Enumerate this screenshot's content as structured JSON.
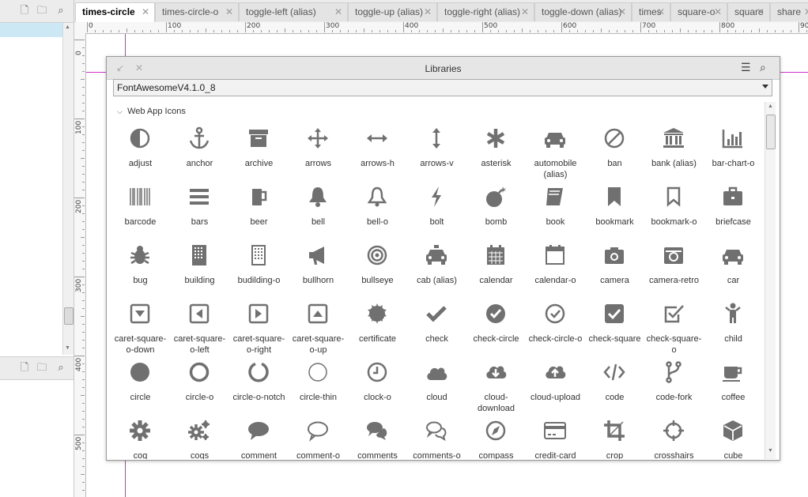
{
  "tabs": [
    {
      "label": "times-circle",
      "active": true
    },
    {
      "label": "times-circle-o",
      "active": false
    },
    {
      "label": "toggle-left (alias)",
      "active": false
    },
    {
      "label": "toggle-up (alias)",
      "active": false
    },
    {
      "label": "toggle-right (alias)",
      "active": false
    },
    {
      "label": "toggle-down (alias)",
      "active": false
    },
    {
      "label": "times",
      "active": false
    },
    {
      "label": "square-o",
      "active": false
    },
    {
      "label": "square",
      "active": false
    },
    {
      "label": "share",
      "active": false
    }
  ],
  "ruler": {
    "top_labels": [
      "0",
      "100",
      "200",
      "300",
      "400",
      "500",
      "600",
      "700",
      "800",
      "900"
    ],
    "left_labels": [
      "0",
      "100",
      "200",
      "300",
      "400",
      "500"
    ]
  },
  "dialog": {
    "title": "Libraries",
    "library_select": "FontAwesomeV4.1.0_8",
    "section": "Web App Icons",
    "colors": {
      "icon": "#707070",
      "accent": "#cc33cc",
      "selected": "#cce8f5"
    }
  },
  "icons": [
    {
      "label": "adjust",
      "icon": "adjust-icon"
    },
    {
      "label": "anchor",
      "icon": "anchor-icon"
    },
    {
      "label": "archive",
      "icon": "archive-icon"
    },
    {
      "label": "arrows",
      "icon": "arrows-icon"
    },
    {
      "label": "arrows-h",
      "icon": "arrows-h-icon"
    },
    {
      "label": "arrows-v",
      "icon": "arrows-v-icon"
    },
    {
      "label": "asterisk",
      "icon": "asterisk-icon"
    },
    {
      "label": "automobile (alias)",
      "icon": "automobile-icon"
    },
    {
      "label": "ban",
      "icon": "ban-icon"
    },
    {
      "label": "bank (alias)",
      "icon": "bank-icon"
    },
    {
      "label": "bar-chart-o",
      "icon": "bar-chart-icon"
    },
    {
      "label": "barcode",
      "icon": "barcode-icon"
    },
    {
      "label": "bars",
      "icon": "bars-icon"
    },
    {
      "label": "beer",
      "icon": "beer-icon"
    },
    {
      "label": "bell",
      "icon": "bell-icon"
    },
    {
      "label": "bell-o",
      "icon": "bell-o-icon"
    },
    {
      "label": "bolt",
      "icon": "bolt-icon"
    },
    {
      "label": "bomb",
      "icon": "bomb-icon"
    },
    {
      "label": "book",
      "icon": "book-icon"
    },
    {
      "label": "bookmark",
      "icon": "bookmark-icon"
    },
    {
      "label": "bookmark-o",
      "icon": "bookmark-o-icon"
    },
    {
      "label": "briefcase",
      "icon": "briefcase-icon"
    },
    {
      "label": "bug",
      "icon": "bug-icon"
    },
    {
      "label": "building",
      "icon": "building-icon"
    },
    {
      "label": "budilding-o",
      "icon": "building-o-icon"
    },
    {
      "label": "bullhorn",
      "icon": "bullhorn-icon"
    },
    {
      "label": "bullseye",
      "icon": "bullseye-icon"
    },
    {
      "label": "cab (alias)",
      "icon": "cab-icon"
    },
    {
      "label": "calendar",
      "icon": "calendar-icon"
    },
    {
      "label": "calendar-o",
      "icon": "calendar-o-icon"
    },
    {
      "label": "camera",
      "icon": "camera-icon"
    },
    {
      "label": "camera-retro",
      "icon": "camera-retro-icon"
    },
    {
      "label": "car",
      "icon": "car-icon"
    },
    {
      "label": "caret-square-o-down",
      "icon": "caret-square-o-down-icon"
    },
    {
      "label": "caret-square-o-left",
      "icon": "caret-square-o-left-icon"
    },
    {
      "label": "caret-square-o-right",
      "icon": "caret-square-o-right-icon"
    },
    {
      "label": "caret-square-o-up",
      "icon": "caret-square-o-up-icon"
    },
    {
      "label": "certificate",
      "icon": "certificate-icon"
    },
    {
      "label": "check",
      "icon": "check-icon"
    },
    {
      "label": "check-circle",
      "icon": "check-circle-icon"
    },
    {
      "label": "check-circle-o",
      "icon": "check-circle-o-icon"
    },
    {
      "label": "check-square",
      "icon": "check-square-icon"
    },
    {
      "label": "check-square-o",
      "icon": "check-square-o-icon"
    },
    {
      "label": "child",
      "icon": "child-icon"
    },
    {
      "label": "circle",
      "icon": "circle-icon"
    },
    {
      "label": "circle-o",
      "icon": "circle-o-icon"
    },
    {
      "label": "circle-o-notch",
      "icon": "circle-o-notch-icon"
    },
    {
      "label": "circle-thin",
      "icon": "circle-thin-icon"
    },
    {
      "label": "clock-o",
      "icon": "clock-o-icon"
    },
    {
      "label": "cloud",
      "icon": "cloud-icon"
    },
    {
      "label": "cloud-download",
      "icon": "cloud-download-icon"
    },
    {
      "label": "cloud-upload",
      "icon": "cloud-upload-icon"
    },
    {
      "label": "code",
      "icon": "code-icon"
    },
    {
      "label": "code-fork",
      "icon": "code-fork-icon"
    },
    {
      "label": "coffee",
      "icon": "coffee-icon"
    },
    {
      "label": "cog",
      "icon": "cog-icon"
    },
    {
      "label": "cogs",
      "icon": "cogs-icon"
    },
    {
      "label": "comment",
      "icon": "comment-icon"
    },
    {
      "label": "comment-o",
      "icon": "comment-o-icon"
    },
    {
      "label": "comments",
      "icon": "comments-icon"
    },
    {
      "label": "comments-o",
      "icon": "comments-o-icon"
    },
    {
      "label": "compass",
      "icon": "compass-icon"
    },
    {
      "label": "credit-card",
      "icon": "credit-card-icon"
    },
    {
      "label": "crop",
      "icon": "crop-icon"
    },
    {
      "label": "crosshairs",
      "icon": "crosshairs-icon"
    },
    {
      "label": "cube",
      "icon": "cube-icon"
    }
  ]
}
